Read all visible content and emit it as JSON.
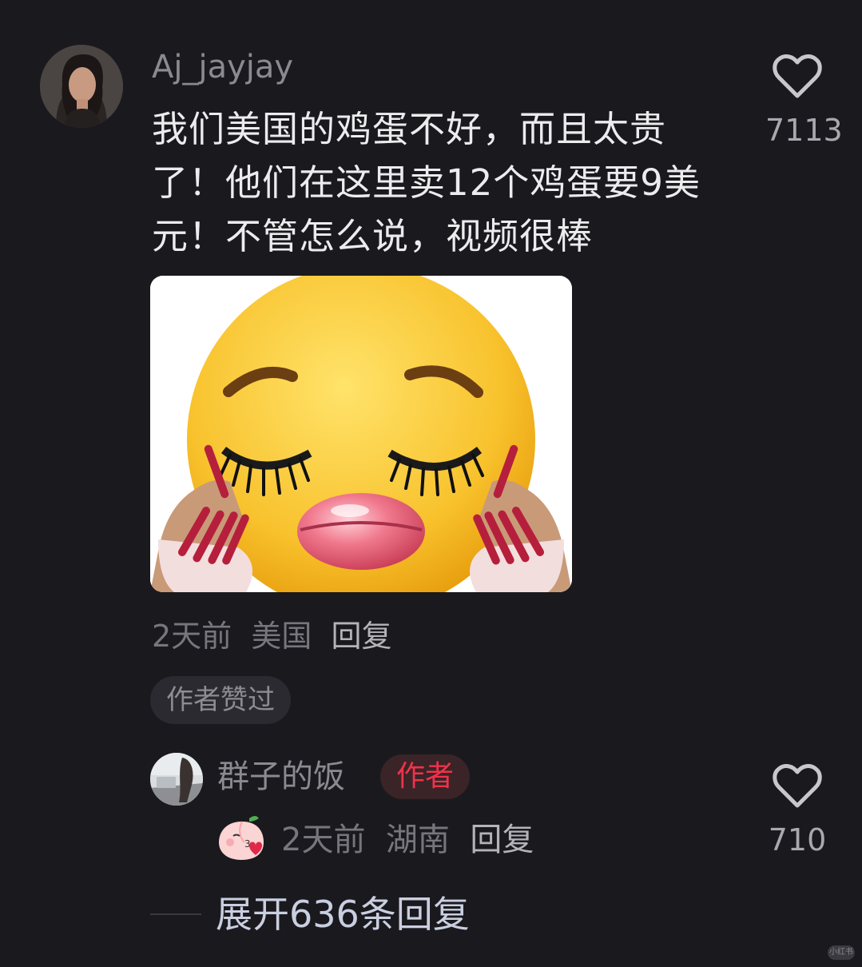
{
  "comment": {
    "username": "Aj_jayjay",
    "text": "我们美国的鸡蛋不好，而且太贵了！他们在这里卖12个鸡蛋要9美元！不管怎么说，视频很棒",
    "likes": "7113",
    "time": "2天前",
    "location": "美国",
    "reply_label": "回复",
    "author_liked_label": "作者赞过",
    "sticker_icon": "kissing-face-with-lashes-and-nails"
  },
  "reply": {
    "username": "群子的饭",
    "badge": "作者",
    "time": "2天前",
    "location": "湖南",
    "reply_label": "回复",
    "likes": "710",
    "emoji_icon": "peach-kiss-icon"
  },
  "expand_label": "展开636条回复",
  "watermark": "小红书",
  "colors": {
    "background": "#1a191e",
    "author_badge": "#f0324b"
  }
}
